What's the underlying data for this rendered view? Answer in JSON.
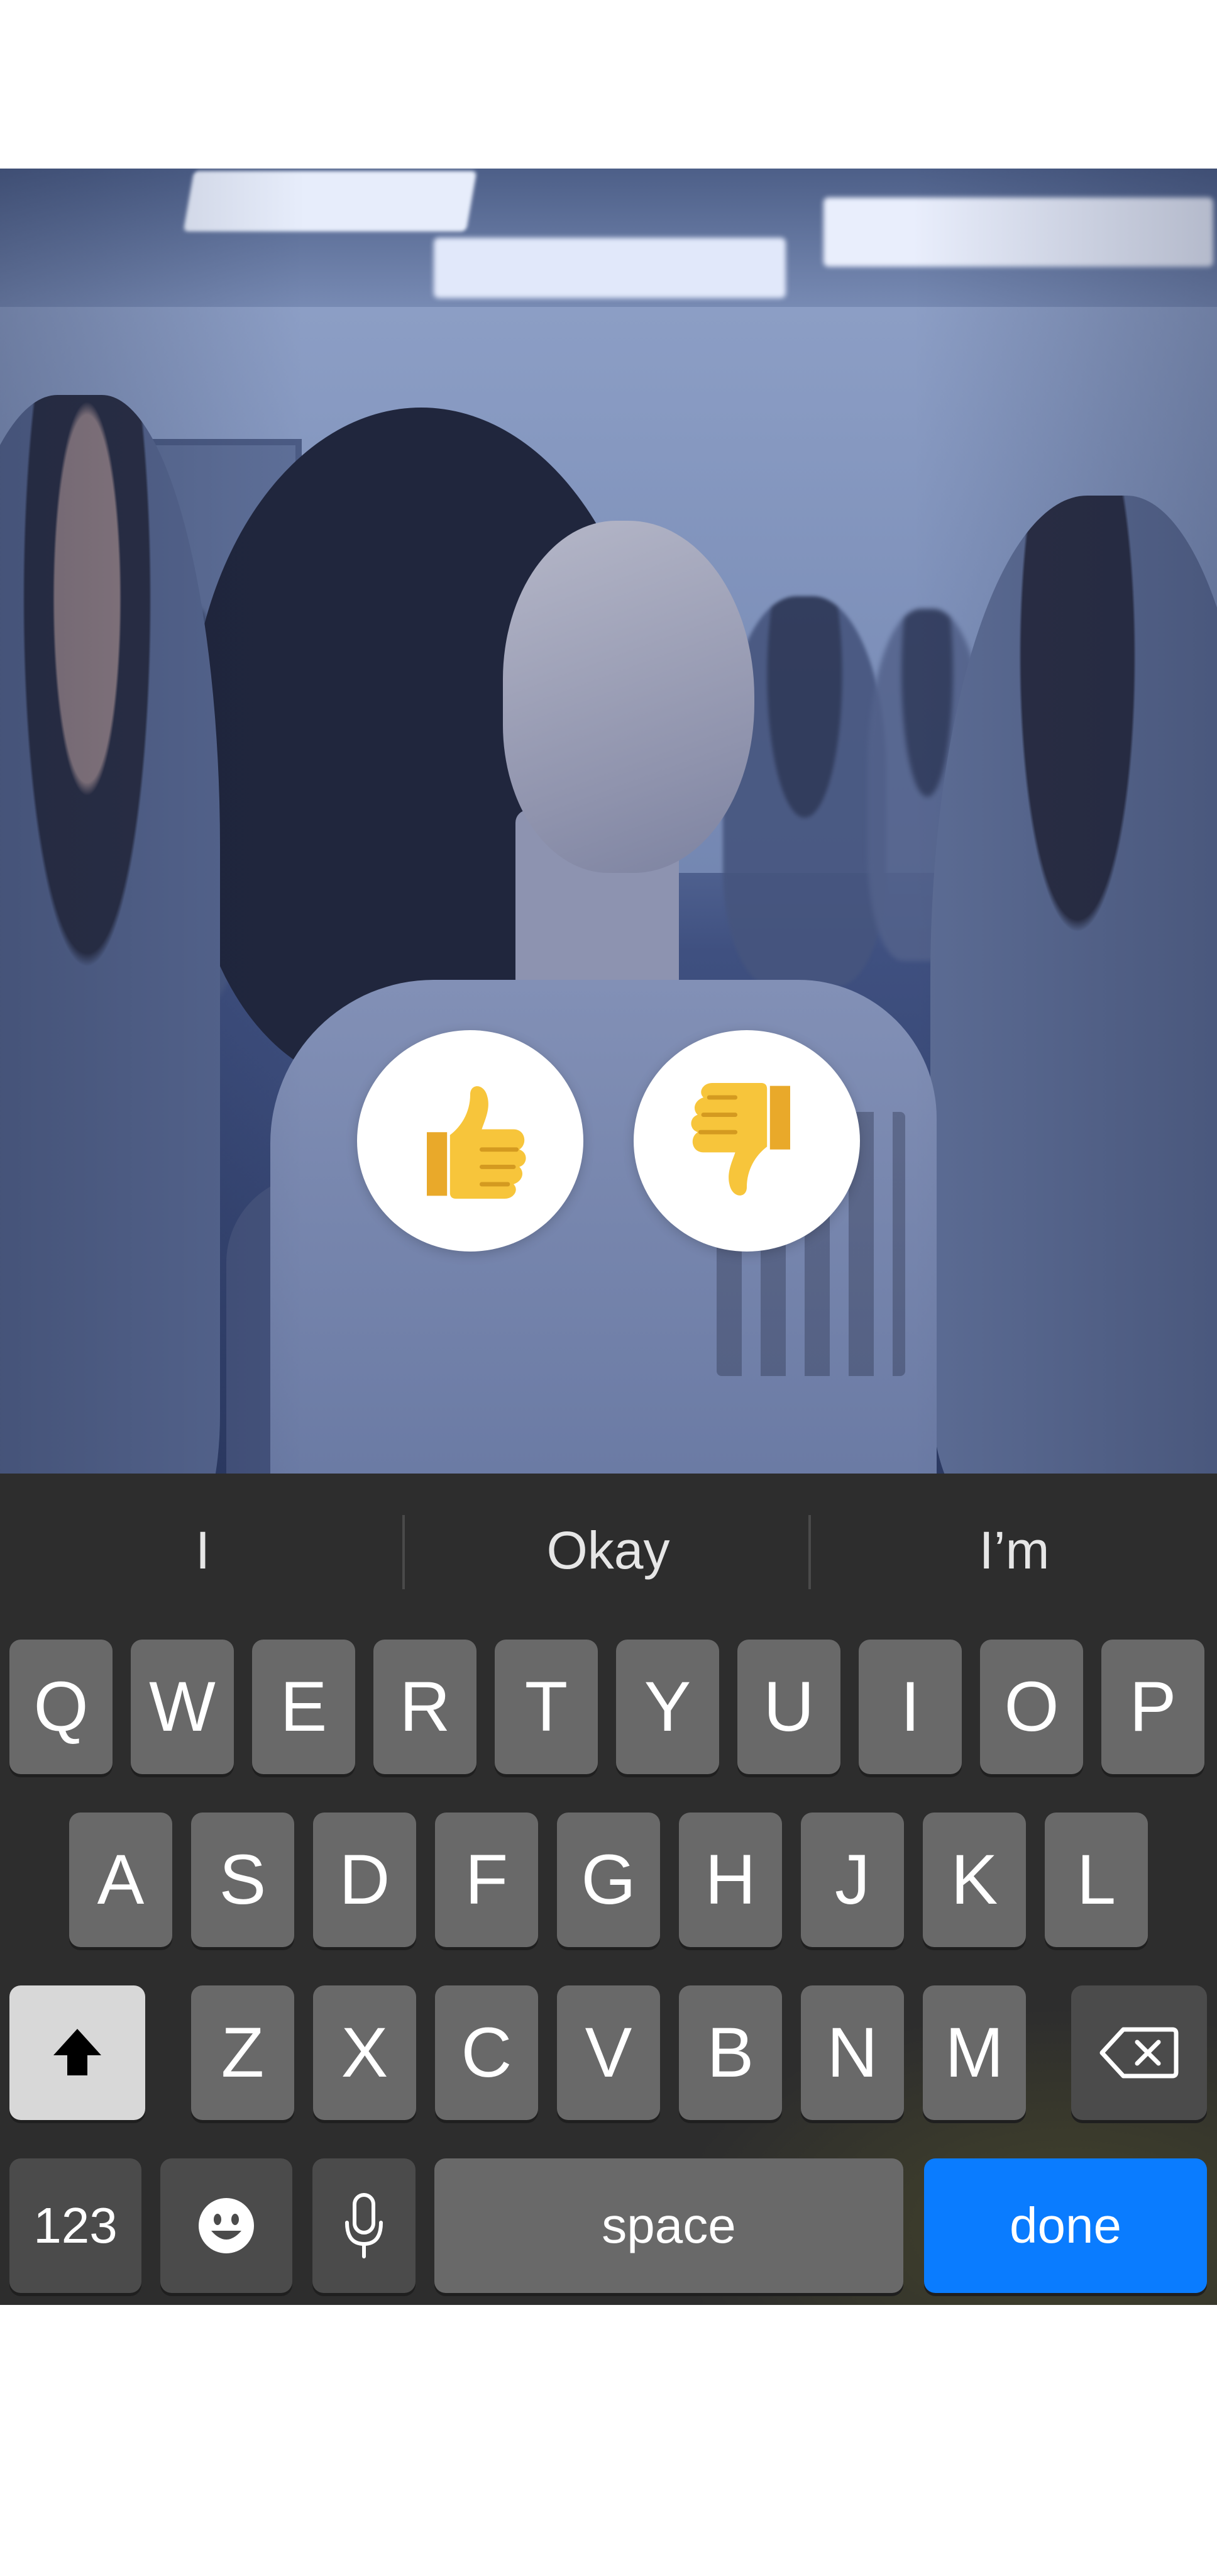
{
  "photo": {
    "icon": "classroom-photo"
  },
  "reactions": {
    "thumbs_up": {
      "icon": "thumbs-up-icon",
      "color": "#f7c53b"
    },
    "thumbs_down": {
      "icon": "thumbs-down-icon",
      "color": "#f7c53b"
    }
  },
  "keyboard": {
    "suggestions": [
      "I",
      "Okay",
      "I’m"
    ],
    "row1": [
      "Q",
      "W",
      "E",
      "R",
      "T",
      "Y",
      "U",
      "I",
      "O",
      "P"
    ],
    "row2": [
      "A",
      "S",
      "D",
      "F",
      "G",
      "H",
      "J",
      "K",
      "L"
    ],
    "row3": [
      "Z",
      "X",
      "C",
      "V",
      "B",
      "N",
      "M"
    ],
    "shift": {
      "icon": "shift-arrow-icon"
    },
    "backspace": {
      "icon": "backspace-icon"
    },
    "numbers_label": "123",
    "emoji": {
      "icon": "emoji-icon"
    },
    "mic": {
      "icon": "microphone-icon"
    },
    "space_label": "space",
    "done_label": "done",
    "colors": {
      "key": "#696969",
      "function_key": "#4b4b4b",
      "shift_active": "#d8d8d8",
      "done": "#0a7cff",
      "background": "#2d2d2d"
    }
  }
}
